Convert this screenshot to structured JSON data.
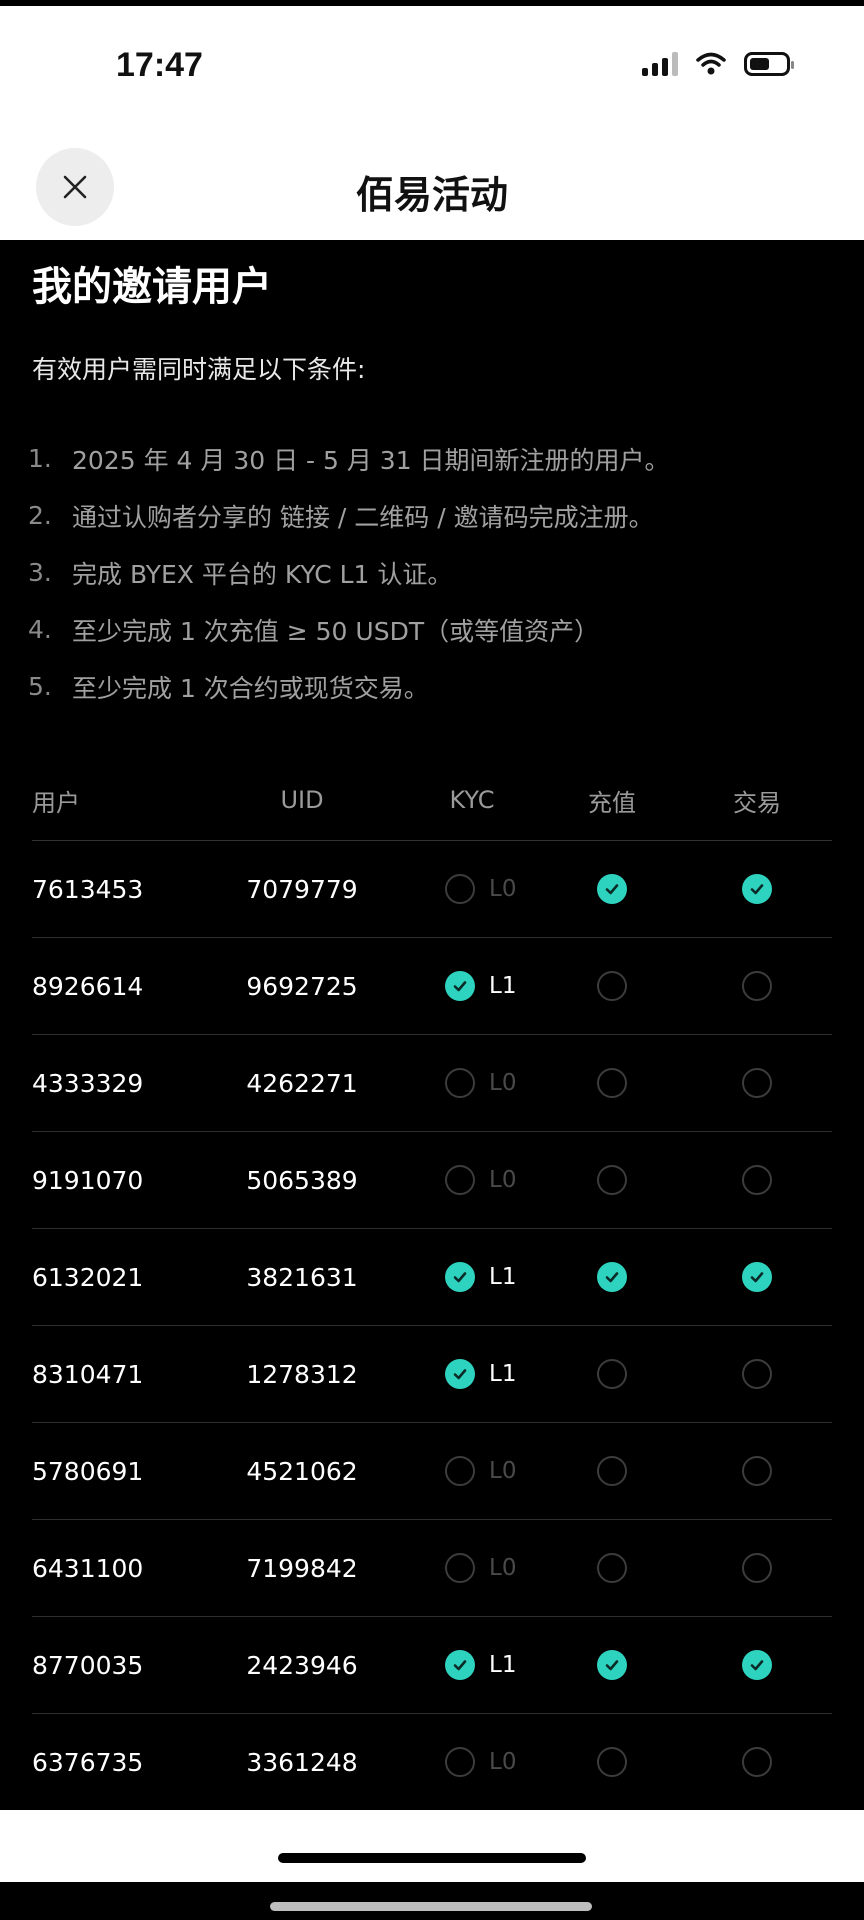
{
  "status_bar": {
    "time": "17:47",
    "icons": [
      "signal-icon",
      "wifi-icon",
      "battery-icon"
    ]
  },
  "header": {
    "close_icon": "close-icon",
    "title": "佰易活动"
  },
  "section": {
    "title": "我的邀请用户",
    "intro": "有效用户需同时满足以下条件:",
    "conditions": [
      {
        "num": "1.",
        "text": "2025 年 4 月 30 日 - 5 月 31 日期间新注册的用户。"
      },
      {
        "num": "2.",
        "text": "通过认购者分享的 链接 / 二维码 / 邀请码完成注册。"
      },
      {
        "num": "3.",
        "text": "完成 BYEX 平台的 KYC L1 认证。"
      },
      {
        "num": "4.",
        "text": "至少完成 1 次充值 ≥ 50 USDT（或等值资产）"
      },
      {
        "num": "5.",
        "text": "至少完成 1 次合约或现货交易。"
      }
    ]
  },
  "table": {
    "headers": {
      "user": "用户",
      "uid": "UID",
      "kyc": "KYC",
      "deposit": "充值",
      "trade": "交易"
    },
    "rows": [
      {
        "user": "7613453",
        "uid": "7079779",
        "kyc_done": false,
        "kyc_level": "L0",
        "deposit": true,
        "trade": true
      },
      {
        "user": "8926614",
        "uid": "9692725",
        "kyc_done": true,
        "kyc_level": "L1",
        "deposit": false,
        "trade": false
      },
      {
        "user": "4333329",
        "uid": "4262271",
        "kyc_done": false,
        "kyc_level": "L0",
        "deposit": false,
        "trade": false
      },
      {
        "user": "9191070",
        "uid": "5065389",
        "kyc_done": false,
        "kyc_level": "L0",
        "deposit": false,
        "trade": false
      },
      {
        "user": "6132021",
        "uid": "3821631",
        "kyc_done": true,
        "kyc_level": "L1",
        "deposit": true,
        "trade": true
      },
      {
        "user": "8310471",
        "uid": "1278312",
        "kyc_done": true,
        "kyc_level": "L1",
        "deposit": false,
        "trade": false
      },
      {
        "user": "5780691",
        "uid": "4521062",
        "kyc_done": false,
        "kyc_level": "L0",
        "deposit": false,
        "trade": false
      },
      {
        "user": "6431100",
        "uid": "7199842",
        "kyc_done": false,
        "kyc_level": "L0",
        "deposit": false,
        "trade": false
      },
      {
        "user": "8770035",
        "uid": "2423946",
        "kyc_done": true,
        "kyc_level": "L1",
        "deposit": true,
        "trade": true
      },
      {
        "user": "6376735",
        "uid": "3361248",
        "kyc_done": false,
        "kyc_level": "L0",
        "deposit": false,
        "trade": false
      }
    ]
  },
  "colors": {
    "accent_check": "#2ed3bf",
    "background": "#000000",
    "header_bg": "#ffffff"
  }
}
